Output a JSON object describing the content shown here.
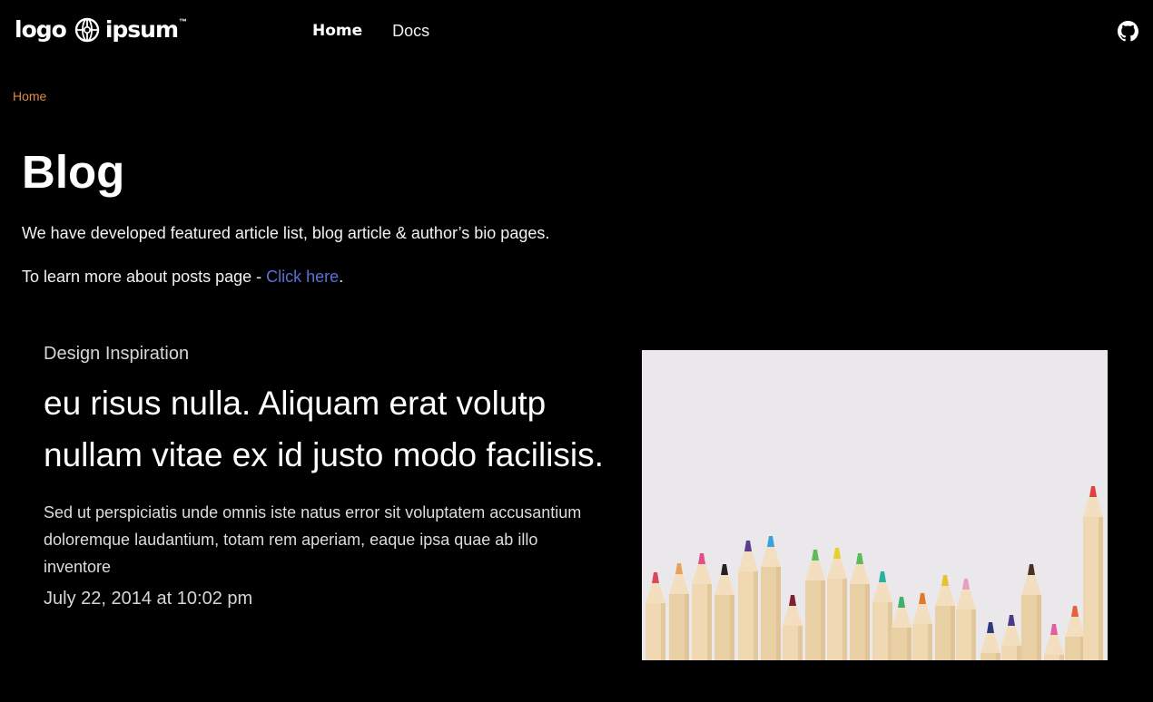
{
  "header": {
    "logo": {
      "word_left": "logo",
      "word_right": "ipsum",
      "icon": "globe-icon"
    },
    "nav": [
      {
        "label": "Home",
        "active": true
      },
      {
        "label": "Docs",
        "active": false
      }
    ],
    "github_icon": "github-icon"
  },
  "breadcrumb": {
    "current": "Home"
  },
  "intro": {
    "title": "Blog",
    "description": "We have developed featured article list, blog article & author’s bio pages.",
    "learn_more_prefix": "To learn more about posts page - ",
    "learn_more_link": "Click here",
    "learn_more_suffix": "."
  },
  "featured_article": {
    "category": "Design Inspiration",
    "title": "eu risus nulla. Aliquam erat volutp nullam vitae ex id justo modo facilisis.",
    "excerpt": "Sed ut perspiciatis unde omnis iste natus error sit voluptatem accusantium doloremque laudantium, totam rem aperiam, eaque ipsa quae ab illo inventore",
    "date": "July 22, 2014 at 10:02 pm",
    "image": "colored-pencils-photo"
  },
  "colors": {
    "background": "#000000",
    "breadcrumb": "#e08a3e",
    "link": "#5d6fd6",
    "text": "#ffffff"
  }
}
